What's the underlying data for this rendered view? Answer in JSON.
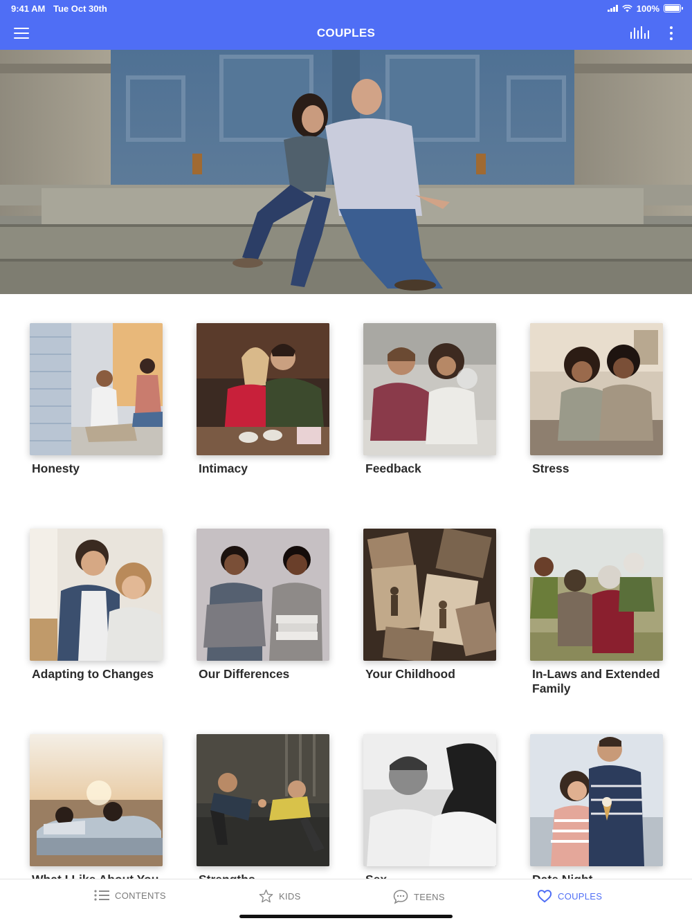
{
  "status_bar": {
    "time": "9:41 AM",
    "date": "Tue Oct 30th",
    "battery": "100%"
  },
  "app_bar": {
    "title": "COUPLES"
  },
  "hero": {
    "icon": "couple-photo"
  },
  "topics": [
    {
      "label": "Honesty",
      "image": "couple-sitting-by-window"
    },
    {
      "label": "Intimacy",
      "image": "couple-kissing-with-coffee"
    },
    {
      "label": "Feedback",
      "image": "couple-talking-on-couch"
    },
    {
      "label": "Stress",
      "image": "couple-laughing-on-sofa"
    },
    {
      "label": "Adapting to Changes",
      "image": "couple-hugging-with-keys"
    },
    {
      "label": "Our Differences",
      "image": "couple-holding-laundry"
    },
    {
      "label": "Your Childhood",
      "image": "old-photographs"
    },
    {
      "label": "In-Laws and Extended Family",
      "image": "family-piggyback"
    },
    {
      "label": "What I Like About You",
      "image": "couple-in-convertible"
    },
    {
      "label": "Strengths",
      "image": "couple-high-five-gym"
    },
    {
      "label": "Sex",
      "image": "couple-black-and-white"
    },
    {
      "label": "Date Night",
      "image": "couple-eating-ice-cream"
    }
  ],
  "tabs": [
    {
      "label": "CONTENTS",
      "icon": "list-icon",
      "active": false
    },
    {
      "label": "KIDS",
      "icon": "star-icon",
      "active": false
    },
    {
      "label": "TEENS",
      "icon": "chat-bubble-icon",
      "active": false
    },
    {
      "label": "COUPLES",
      "icon": "heart-icon",
      "active": true
    }
  ],
  "colors": {
    "accent": "#4f6ef5",
    "text": "#2b2b2b",
    "tab_inactive": "#7a7a7a"
  }
}
